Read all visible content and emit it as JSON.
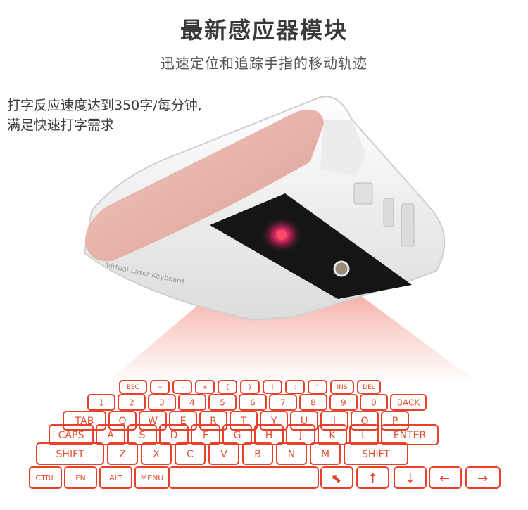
{
  "header": {
    "title": "最新感应器模块",
    "subtitle": "迅速定位和追踪手指的移动轨迹"
  },
  "description": {
    "line1": "打字反应速度达到350字/每分钟,",
    "line2": "满足快速打字需求"
  },
  "device": {
    "side_text": "Virtual Laser Keyboard"
  },
  "keyboard": {
    "row0": [
      "ESC",
      "~",
      "-",
      "+",
      "{",
      "}",
      "|",
      ":",
      "\"",
      "INS",
      "DEL"
    ],
    "row1": [
      "1",
      "2",
      "3",
      "4",
      "5",
      "6",
      "7",
      "8",
      "9",
      "0",
      "BACK"
    ],
    "row2": [
      "TAB",
      "Q",
      "W",
      "E",
      "R",
      "T",
      "Y",
      "U",
      "I",
      "O",
      "P"
    ],
    "row3": [
      "CAPS",
      "A",
      "S",
      "D",
      "F",
      "G",
      "H",
      "J",
      "K",
      "L",
      "ENTER"
    ],
    "row4": [
      "SHIFT",
      "Z",
      "X",
      "C",
      "V",
      "B",
      "N",
      "M",
      "SHIFT"
    ],
    "row5": [
      "CTRL",
      "FN",
      "ALT",
      "MENU"
    ]
  },
  "colors": {
    "laser": "#e8402a",
    "device_body": "#f2f2f2",
    "panel": "#e9b7ae",
    "sensor": "#1a1a1a"
  }
}
